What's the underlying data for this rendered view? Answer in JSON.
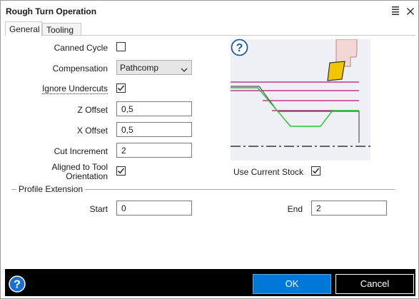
{
  "window": {
    "title": "Rough Turn Operation",
    "menu_icon": "hamburger-menu-icon",
    "close_icon": "close-icon"
  },
  "tabs": [
    {
      "label": "General",
      "active": true
    },
    {
      "label": "Tooling",
      "active": false
    }
  ],
  "form": {
    "canned_cycle": {
      "label": "Canned Cycle",
      "checked": false
    },
    "compensation": {
      "label": "Compensation",
      "value": "Pathcomp"
    },
    "ignore_undercuts": {
      "label": "Ignore Undercuts",
      "checked": true
    },
    "z_offset": {
      "label": "Z Offset",
      "value": "0,5"
    },
    "x_offset": {
      "label": "X Offset",
      "value": "0,5"
    },
    "cut_increment": {
      "label": "Cut Increment",
      "value": "2"
    },
    "aligned_to_tool": {
      "label": "Aligned to Tool Orientation",
      "checked": true
    },
    "use_current_stock": {
      "label": "Use Current Stock",
      "checked": true
    }
  },
  "profile_extension": {
    "group_title": "Profile Extension",
    "start": {
      "label": "Start",
      "value": "0"
    },
    "end": {
      "label": "End",
      "value": "2"
    }
  },
  "footer": {
    "help_icon": "help-circle-icon",
    "ok_label": "OK",
    "cancel_label": "Cancel"
  },
  "colors": {
    "accent": "#0078d7",
    "footer_bg": "#000000",
    "preview_bg": "#eef0f5",
    "cut_lines": "#b0157a",
    "profile_green": "#22c433",
    "insert_yellow": "#f2c500"
  }
}
